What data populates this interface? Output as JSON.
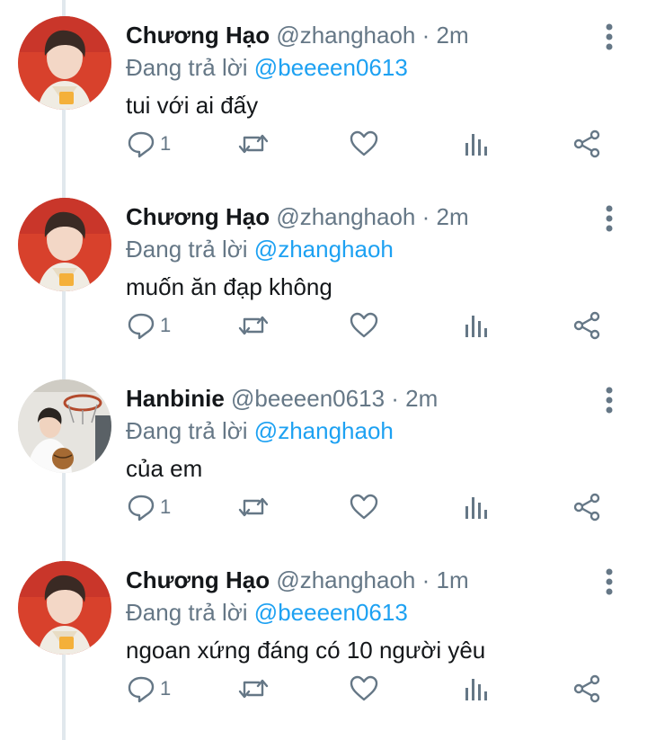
{
  "colors": {
    "link": "#1da1f2",
    "muted": "#657786",
    "text": "#14171a",
    "thread_line": "#e1e8ed"
  },
  "icons": {
    "reply": "reply-icon",
    "retweet": "retweet-icon",
    "like": "heart-icon",
    "stats": "analytics-icon",
    "share": "share-icon",
    "more": "more-vertical-icon"
  },
  "tweets": [
    {
      "name": "Chương Hạo",
      "handle": "@zhanghaoh",
      "dot": "·",
      "time": "2m",
      "reply_prefix": "Đang trả lời",
      "reply_to": "@beeeen0613",
      "text": "tui với ai đấy",
      "reply_count": "1"
    },
    {
      "name": "Chương Hạo",
      "handle": "@zhanghaoh",
      "dot": "·",
      "time": "2m",
      "reply_prefix": "Đang trả lời",
      "reply_to": "@zhanghaoh",
      "text": "muốn ăn đạp không",
      "reply_count": "1"
    },
    {
      "name": "Hanbinie",
      "handle": "@beeeen0613",
      "dot": "·",
      "time": "2m",
      "reply_prefix": "Đang trả lời",
      "reply_to": "@zhanghaoh",
      "text": "của em",
      "reply_count": "1"
    },
    {
      "name": "Chương Hạo",
      "handle": "@zhanghaoh",
      "dot": "·",
      "time": "1m",
      "reply_prefix": "Đang trả lời",
      "reply_to": "@beeeen0613",
      "text": "ngoan xứng đáng có 10 người yêu",
      "reply_count": "1"
    }
  ]
}
